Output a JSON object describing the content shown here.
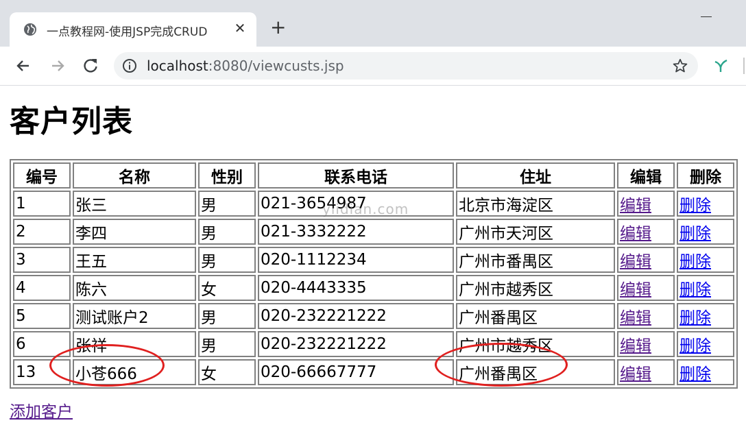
{
  "browser": {
    "tab_title": "一点教程网-使用JSP完成CRUD",
    "tab_close": "✕",
    "new_tab": "+",
    "url_host": "localhost",
    "url_rest": ":8080/viewcusts.jsp"
  },
  "page": {
    "heading": "客户列表",
    "watermark": "yiidian.com",
    "add_link": "添加客户"
  },
  "table": {
    "headers": [
      "编号",
      "名称",
      "性别",
      "联系电话",
      "住址",
      "编辑",
      "删除"
    ],
    "rows": [
      {
        "id": "1",
        "name": "张三",
        "sex": "男",
        "phone": "021-3654987",
        "address": "北京市海淀区",
        "edit": "编辑",
        "delete": "删除"
      },
      {
        "id": "2",
        "name": "李四",
        "sex": "男",
        "phone": "021-3332222",
        "address": "广州市天河区",
        "edit": "编辑",
        "delete": "删除"
      },
      {
        "id": "3",
        "name": "王五",
        "sex": "男",
        "phone": "020-1112234",
        "address": "广州市番禺区",
        "edit": "编辑",
        "delete": "删除"
      },
      {
        "id": "4",
        "name": "陈六",
        "sex": "女",
        "phone": "020-4443335",
        "address": "广州市越秀区",
        "edit": "编辑",
        "delete": "删除"
      },
      {
        "id": "5",
        "name": "测试账户2",
        "sex": "男",
        "phone": "020-232221222",
        "address": "广州番禺区",
        "edit": "编辑",
        "delete": "删除"
      },
      {
        "id": "6",
        "name": "张祥",
        "sex": "男",
        "phone": "020-232221222",
        "address": "广州市越秀区",
        "edit": "编辑",
        "delete": "删除"
      },
      {
        "id": "13",
        "name": "小苍666",
        "sex": "女",
        "phone": "020-66667777",
        "address": "广州番禺区",
        "edit": "编辑",
        "delete": "删除"
      }
    ]
  },
  "icons": {
    "favicon": "globe-icon",
    "back": "arrow-left-icon",
    "forward": "arrow-right-icon",
    "reload": "reload-icon",
    "info": "info-icon",
    "bookmark": "star-icon",
    "extension": "extension-icon"
  },
  "colors": {
    "annotation": "#e0201f",
    "visited_link": "#551a8b",
    "link": "#0000ee"
  }
}
